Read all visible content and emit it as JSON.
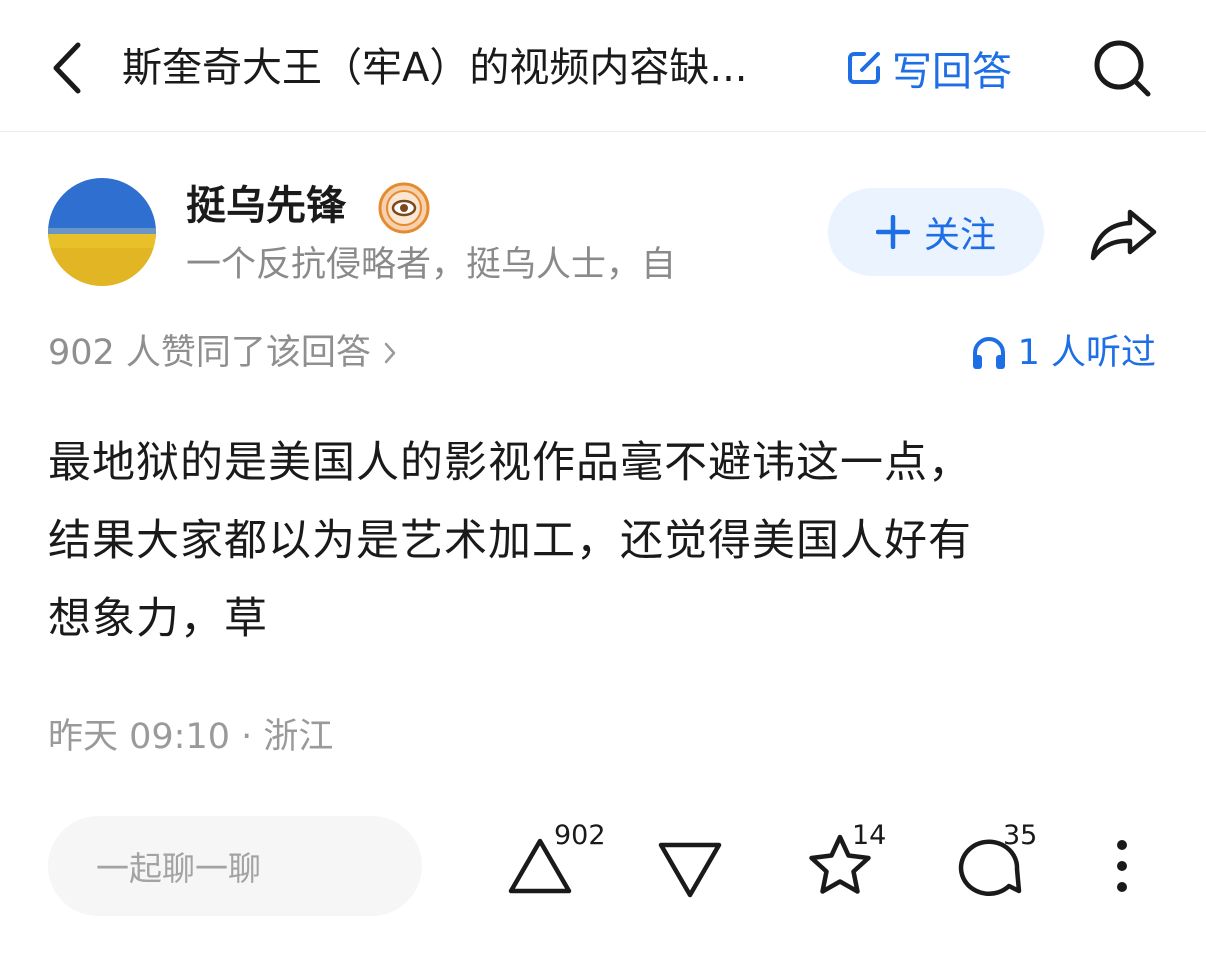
{
  "header": {
    "title": "斯奎奇大王（牢A）的视频内容缺...",
    "write_answer_label": "写回答"
  },
  "author": {
    "name": "挺乌先锋",
    "bio": "一个反抗侵略者，挺乌人士，自"
  },
  "follow_label": "关注",
  "likes_summary": "902 人赞同了该回答",
  "listen_summary": "1 人听过",
  "content": {
    "lines": [
      "最地狱的是美国人的影视作品毫不避讳这一点，",
      "结果大家都以为是艺术加工，还觉得美国人好有",
      "想象力，草"
    ]
  },
  "timestamp": "昨天 09:10 · 浙江",
  "action_bar": {
    "comment_placeholder": "一起聊一聊",
    "upvote_count": "902",
    "favorite_count": "14",
    "comment_count": "35"
  },
  "colors": {
    "accent": "#1e6fe6",
    "follow_bg": "#ebf3fe",
    "avatar_sky": "#2f6fd0",
    "avatar_field": "#e8c12a",
    "badge": "#e58a2e"
  },
  "icons": [
    "chevron-left-icon",
    "edit-icon",
    "search-icon",
    "badge-icon",
    "plus-icon",
    "share-icon",
    "headphones-icon",
    "upvote-icon",
    "downvote-icon",
    "star-icon",
    "comment-icon",
    "more-icon"
  ]
}
